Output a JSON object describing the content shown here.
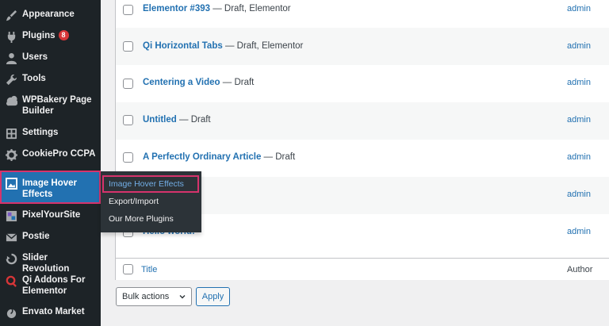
{
  "sidebar": {
    "items": [
      {
        "label": "Appearance",
        "icon": "brush-icon"
      },
      {
        "label": "Plugins",
        "icon": "plug-icon",
        "badge": "8"
      },
      {
        "label": "Users",
        "icon": "user-icon"
      },
      {
        "label": "Tools",
        "icon": "wrench-icon"
      },
      {
        "label": "WPBakery Page Builder",
        "icon": "wpbakery-icon"
      },
      {
        "label": "Settings",
        "icon": "settings-icon"
      },
      {
        "label": "CookiePro CCPA",
        "icon": "gear-icon"
      },
      {
        "label": "Image Hover Effects",
        "icon": "image-icon"
      },
      {
        "label": "PixelYourSite",
        "icon": "pixelyoursite-icon"
      },
      {
        "label": "Postie",
        "icon": "mail-icon"
      },
      {
        "label": "Slider Revolution",
        "icon": "slider-revolution-icon"
      },
      {
        "label": "Qi Addons For Elementor",
        "icon": "qi-icon"
      },
      {
        "label": "Envato Market",
        "icon": "envato-icon"
      }
    ]
  },
  "flyout": {
    "items": [
      "Image Hover Effects",
      "Export/Import",
      "Our More Plugins"
    ]
  },
  "table": {
    "rows": [
      {
        "title": "Elementor #393",
        "state": " — Draft, Elementor",
        "author": "admin"
      },
      {
        "title": "Qi Horizontal Tabs",
        "state": " — Draft, Elementor",
        "author": "admin"
      },
      {
        "title": "Centering a Video",
        "state": " — Draft",
        "author": "admin"
      },
      {
        "title": "Untitled",
        "state": " — Draft",
        "author": "admin"
      },
      {
        "title": "A Perfectly Ordinary Article",
        "state": " — Draft",
        "author": "admin"
      },
      {
        "title": "",
        "state": "",
        "author": "admin"
      },
      {
        "title": "Hello world!",
        "state": "",
        "author": "admin"
      }
    ],
    "footer": {
      "title": "Title",
      "author": "Author"
    }
  },
  "controls": {
    "bulk_actions": "Bulk actions",
    "apply": "Apply"
  },
  "colors": {
    "sidebar_bg": "#1d2327",
    "accent": "#2271b1",
    "highlight": "#d6336c",
    "badge": "#d63638"
  }
}
